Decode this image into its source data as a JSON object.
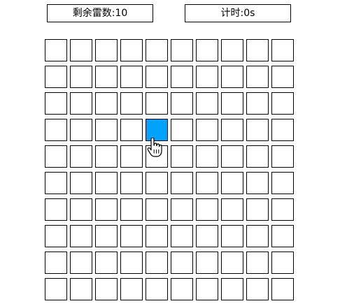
{
  "header": {
    "mines_label": "剩余雷数:",
    "mines_value": "10",
    "timer_label": "计时:",
    "timer_value": "0s"
  },
  "board": {
    "rows": 10,
    "cols": 10,
    "hover_cell": {
      "row": 3,
      "col": 4
    },
    "hover_color": "#00a2ff",
    "cursor_icon": "hand-pointer-icon"
  }
}
